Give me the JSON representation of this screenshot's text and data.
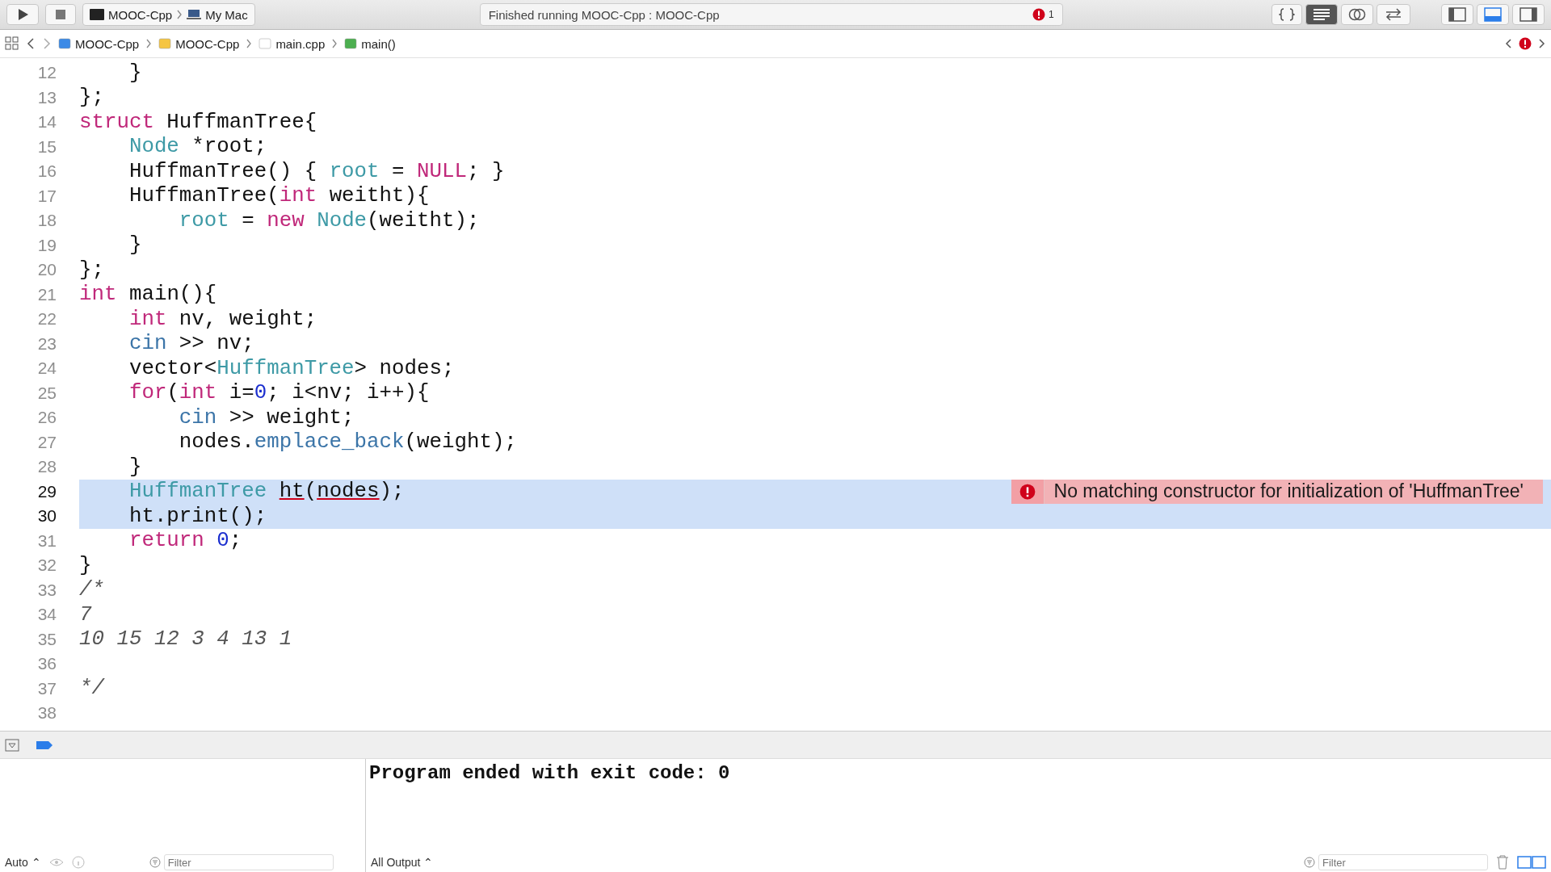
{
  "toolbar": {
    "scheme": "MOOC-Cpp",
    "destination": "My Mac",
    "status": "Finished running MOOC-Cpp : MOOC-Cpp",
    "error_count": "1"
  },
  "breadcrumb": [
    {
      "kind": "project",
      "label": "MOOC-Cpp"
    },
    {
      "kind": "folder",
      "label": "MOOC-Cpp"
    },
    {
      "kind": "file",
      "label": "main.cpp"
    },
    {
      "kind": "function",
      "label": "main()"
    }
  ],
  "editor": {
    "lines": [
      {
        "number": "12",
        "highlighted": false,
        "current": false,
        "tokens": [
          {
            "kind": "plain",
            "text": "    }"
          }
        ]
      },
      {
        "number": "13",
        "highlighted": false,
        "current": false,
        "tokens": [
          {
            "kind": "plain",
            "text": "};"
          }
        ]
      },
      {
        "number": "14",
        "highlighted": false,
        "current": false,
        "tokens": [
          {
            "kind": "kw",
            "text": "struct"
          },
          {
            "kind": "plain",
            "text": " HuffmanTree{"
          }
        ]
      },
      {
        "number": "15",
        "highlighted": false,
        "current": false,
        "tokens": [
          {
            "kind": "type",
            "text": "    Node"
          },
          {
            "kind": "plain",
            "text": " *root;"
          }
        ]
      },
      {
        "number": "16",
        "highlighted": false,
        "current": false,
        "tokens": [
          {
            "kind": "plain",
            "text": "    HuffmanTree() { "
          },
          {
            "kind": "type",
            "text": "root"
          },
          {
            "kind": "plain",
            "text": " = "
          },
          {
            "kind": "kw",
            "text": "NULL"
          },
          {
            "kind": "plain",
            "text": "; }"
          }
        ]
      },
      {
        "number": "17",
        "highlighted": false,
        "current": false,
        "tokens": [
          {
            "kind": "plain",
            "text": "    HuffmanTree("
          },
          {
            "kind": "kw",
            "text": "int"
          },
          {
            "kind": "plain",
            "text": " weitht){"
          }
        ]
      },
      {
        "number": "18",
        "highlighted": false,
        "current": false,
        "tokens": [
          {
            "kind": "type",
            "text": "        root"
          },
          {
            "kind": "plain",
            "text": " = "
          },
          {
            "kind": "kw",
            "text": "new "
          },
          {
            "kind": "type",
            "text": "Node"
          },
          {
            "kind": "plain",
            "text": "(weitht);"
          }
        ]
      },
      {
        "number": "19",
        "highlighted": false,
        "current": false,
        "tokens": [
          {
            "kind": "plain",
            "text": "    }"
          }
        ]
      },
      {
        "number": "20",
        "highlighted": false,
        "current": false,
        "tokens": [
          {
            "kind": "plain",
            "text": "};"
          }
        ]
      },
      {
        "number": "21",
        "highlighted": false,
        "current": false,
        "tokens": [
          {
            "kind": "kw",
            "text": "int"
          },
          {
            "kind": "plain",
            "text": " main(){"
          }
        ]
      },
      {
        "number": "22",
        "highlighted": false,
        "current": false,
        "tokens": [
          {
            "kind": "kw",
            "text": "    int"
          },
          {
            "kind": "plain",
            "text": " nv, weight;"
          }
        ]
      },
      {
        "number": "23",
        "highlighted": false,
        "current": false,
        "tokens": [
          {
            "kind": "lib",
            "text": "    cin"
          },
          {
            "kind": "plain",
            "text": " >> nv;"
          }
        ]
      },
      {
        "number": "24",
        "highlighted": false,
        "current": false,
        "tokens": [
          {
            "kind": "plain",
            "text": "    vector<"
          },
          {
            "kind": "type",
            "text": "HuffmanTree"
          },
          {
            "kind": "plain",
            "text": "> nodes;"
          }
        ]
      },
      {
        "number": "25",
        "highlighted": false,
        "current": false,
        "tokens": [
          {
            "kind": "kw",
            "text": "    for"
          },
          {
            "kind": "plain",
            "text": "("
          },
          {
            "kind": "kw",
            "text": "int"
          },
          {
            "kind": "plain",
            "text": " i="
          },
          {
            "kind": "num",
            "text": "0"
          },
          {
            "kind": "plain",
            "text": "; i<nv; i++){"
          }
        ]
      },
      {
        "number": "26",
        "highlighted": false,
        "current": false,
        "tokens": [
          {
            "kind": "lib",
            "text": "        cin"
          },
          {
            "kind": "plain",
            "text": " >> weight;"
          }
        ]
      },
      {
        "number": "27",
        "highlighted": false,
        "current": false,
        "tokens": [
          {
            "kind": "plain",
            "text": "        nodes."
          },
          {
            "kind": "lib",
            "text": "emplace_back"
          },
          {
            "kind": "plain",
            "text": "(weight);"
          }
        ]
      },
      {
        "number": "28",
        "highlighted": false,
        "current": false,
        "tokens": [
          {
            "kind": "plain",
            "text": "    }"
          }
        ]
      },
      {
        "number": "29",
        "highlighted": true,
        "current": true,
        "error": "No matching constructor for initialization of 'HuffmanTree'",
        "tokens": [
          {
            "kind": "type",
            "text": "    HuffmanTree "
          },
          {
            "kind": "error",
            "text": "ht"
          },
          {
            "kind": "plain",
            "text": "("
          },
          {
            "kind": "error",
            "text": "nodes"
          },
          {
            "kind": "plain",
            "text": ");"
          }
        ]
      },
      {
        "number": "30",
        "highlighted": true,
        "current": true,
        "tokens": [
          {
            "kind": "plain",
            "text": "    ht.print();"
          }
        ]
      },
      {
        "number": "31",
        "highlighted": false,
        "current": false,
        "tokens": [
          {
            "kind": "kw",
            "text": "    return "
          },
          {
            "kind": "num",
            "text": "0"
          },
          {
            "kind": "plain",
            "text": ";"
          }
        ]
      },
      {
        "number": "32",
        "highlighted": false,
        "current": false,
        "tokens": [
          {
            "kind": "plain",
            "text": "}"
          }
        ]
      },
      {
        "number": "33",
        "highlighted": false,
        "current": false,
        "tokens": [
          {
            "kind": "comment",
            "text": "/*"
          }
        ]
      },
      {
        "number": "34",
        "highlighted": false,
        "current": false,
        "tokens": [
          {
            "kind": "comment",
            "text": "7"
          }
        ]
      },
      {
        "number": "35",
        "highlighted": false,
        "current": false,
        "tokens": [
          {
            "kind": "comment",
            "text": "10 15 12 3 4 13 1"
          }
        ]
      },
      {
        "number": "36",
        "highlighted": false,
        "current": false
      },
      {
        "number": "37",
        "highlighted": false,
        "current": false,
        "tokens": [
          {
            "kind": "comment",
            "text": "*/"
          }
        ]
      },
      {
        "number": "38",
        "highlighted": false,
        "current": false
      }
    ]
  },
  "console": {
    "output": "Program ended with exit code: 0",
    "variables_mode": "Auto ⌃",
    "variables_filter": {
      "placeholder": "Filter"
    },
    "output_mode": "All Output ⌃",
    "output_filter": {
      "placeholder": "Filter"
    }
  }
}
